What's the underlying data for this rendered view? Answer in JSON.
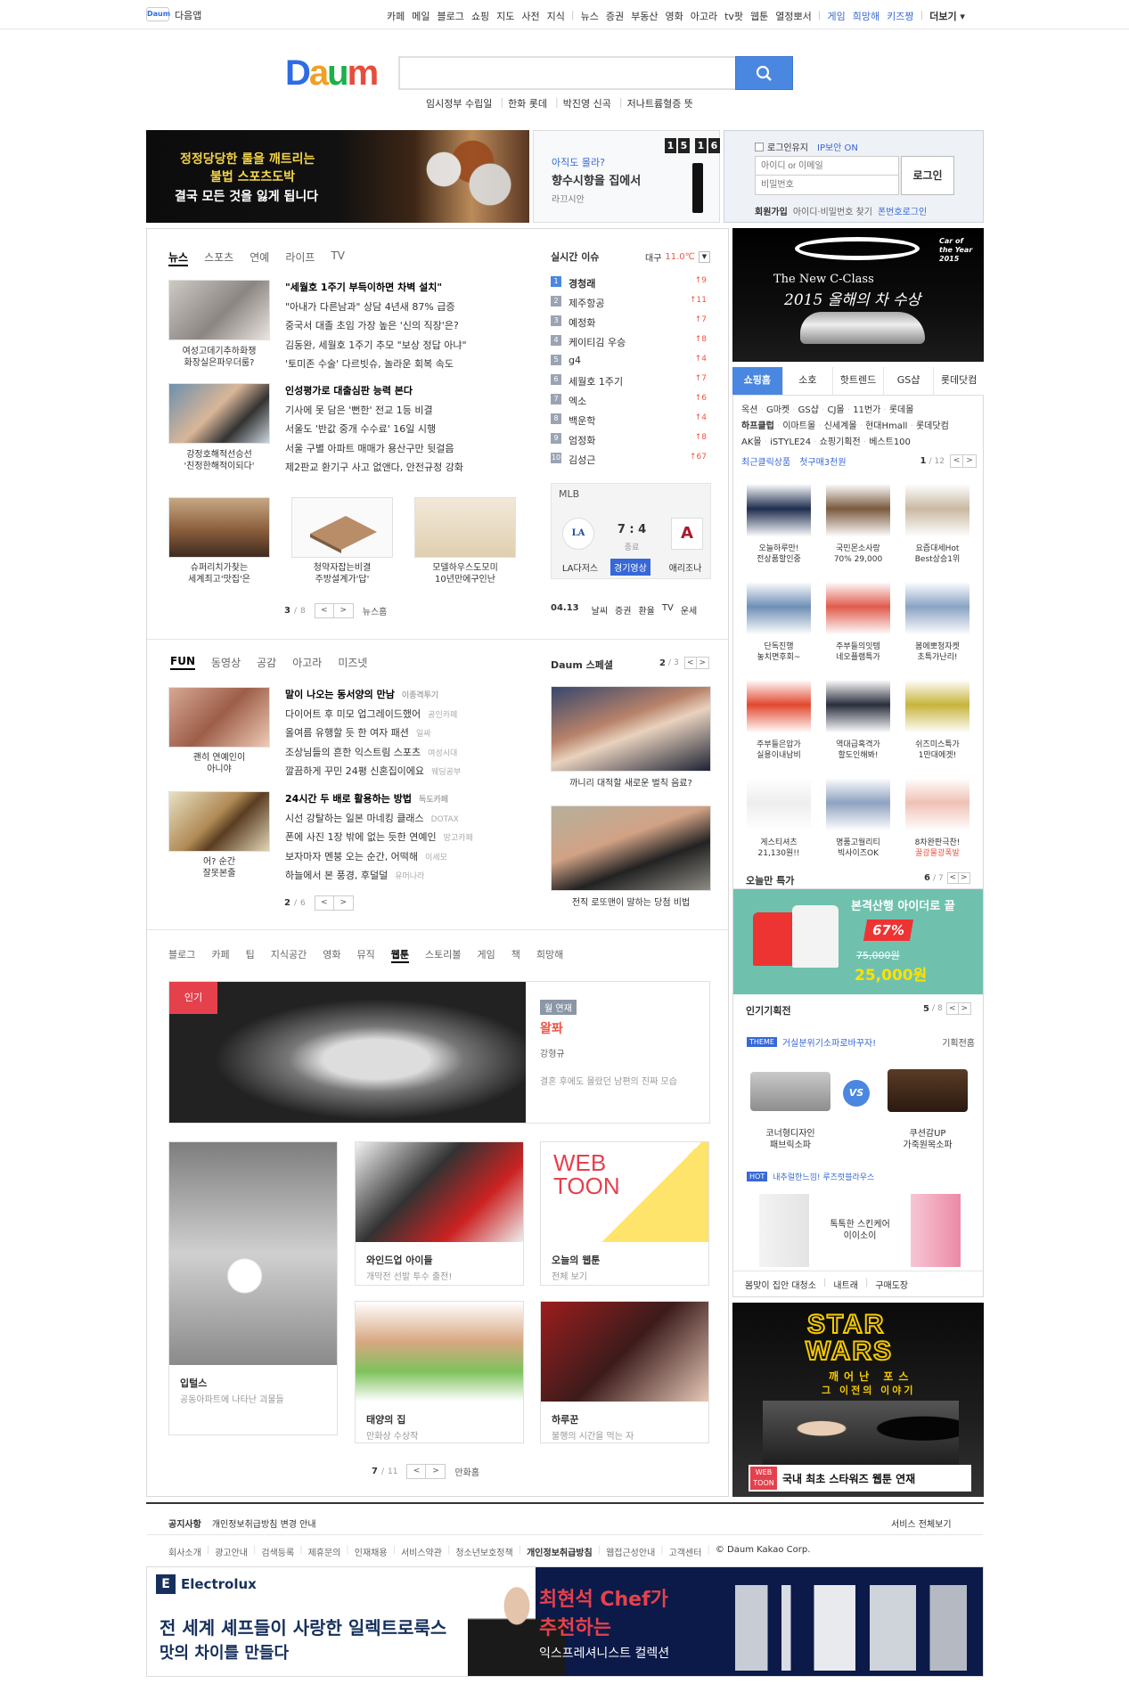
{
  "gnb": {
    "app_name": "다음앱",
    "menu1": [
      "카페",
      "메일",
      "블로그",
      "쇼핑",
      "지도",
      "사전",
      "지식"
    ],
    "menu2": [
      "뉴스",
      "증권",
      "부동산",
      "영화",
      "아고라",
      "tv팟",
      "웹툰",
      "열정뽀서"
    ],
    "menu3": [
      "게임",
      "희망해",
      "키즈짱"
    ],
    "more": "더보기"
  },
  "logo": "Daum",
  "search": {
    "placeholder": ""
  },
  "hot_keywords": [
    "임시정부 수립일",
    "한화 롯데",
    "박진영 신곡",
    "저나트륨혈증 뜻"
  ],
  "banner": {
    "line1": "정정당당한 룰을 깨트리는",
    "line2": "불법 스포츠도박",
    "line3": "결국 모든 것을 잃게 됩니다"
  },
  "ad_small": {
    "q": "아직도 몰라?",
    "title": "향수시향을 집에서",
    "brand": "라끄시안",
    "time": [
      "1",
      "5",
      "1",
      "6"
    ]
  },
  "login": {
    "keep": "로그인유지",
    "ip": "IP보안 ON",
    "id_placeholder": "아이디 or 이메일",
    "pw_placeholder": "비밀번호",
    "button": "로그인",
    "join": "회원가입",
    "find": "아이디·비밀번호 찾기",
    "phone": "폰번호로그인"
  },
  "news": {
    "tabs": [
      "뉴스",
      "스포츠",
      "연예",
      "라이프",
      "TV"
    ],
    "thumb1_cap": [
      "여성고데기추하화쟁",
      "화장실은파우더룸?"
    ],
    "group1": [
      "\"세월호 1주기 부득이하면 차벽 설치\"",
      "\"아내가 다른남과\" 상담 4년새 87% 급증",
      "중국서 대졸 초임 가장 높은 '신의 직장'은?",
      "김동완, 세월호 1주기 추모 \"보상 정답 아냐\"",
      "'토미존 수술' 다르빗슈, 놀라운 회복 속도"
    ],
    "thumb2_cap": [
      "강정호해적선승선",
      "'친정한해적이되다'"
    ],
    "group2": [
      "인성평가로 대출심판 능력 본다",
      "기사에 못 담은 '뻔한' 전교 1등 비결",
      "서울도 '반값 중개 수수료' 16일 시행",
      "서울 구별 아파트 매매가 용산구만 뒷걸음",
      "제2판교 환기구 사고 없앤다, 안전규정 강화"
    ],
    "photos": [
      [
        "슈퍼리치가찾는",
        "세계최고'맛집'은"
      ],
      [
        "청약자잡는비결",
        "주방설계가'답'"
      ],
      [
        "모델하우스도모미",
        "10년만에구인난"
      ]
    ],
    "page": "3",
    "total": "8",
    "more": "뉴스홈"
  },
  "realtime": {
    "title": "실시간 이슈",
    "weather_city": "대구",
    "weather_temp": "11.0℃",
    "items": [
      [
        "1",
        "경청래",
        "9"
      ],
      [
        "2",
        "제주항공",
        "11"
      ],
      [
        "3",
        "예정화",
        "7"
      ],
      [
        "4",
        "케이티김 우승",
        "8"
      ],
      [
        "5",
        "g4",
        "4"
      ],
      [
        "6",
        "세월호 1주기",
        "7"
      ],
      [
        "7",
        "엑소",
        "6"
      ],
      [
        "8",
        "백운학",
        "4"
      ],
      [
        "9",
        "엄정화",
        "8"
      ],
      [
        "10",
        "김성근",
        "67"
      ]
    ]
  },
  "mlb": {
    "label": "MLB",
    "score": "7 : 4",
    "status": "종료",
    "team1": "LA다저스",
    "team2": "애리조나",
    "video": "경기영상"
  },
  "util": {
    "date": "04.13",
    "links": [
      "날씨",
      "증권",
      "환율",
      "TV",
      "운세"
    ]
  },
  "fun": {
    "tabs": [
      "FUN",
      "동영상",
      "공감",
      "아고라",
      "미즈넷"
    ],
    "cap1": [
      "괜히 연예인이",
      "아니야"
    ],
    "group1": [
      [
        "말이 나오는 동서양의 만남",
        "이종격투기"
      ],
      [
        "다이어트 후 미모 업그레이드했어",
        "공인카페"
      ],
      [
        "올여름 유행할 듯 한 여자 패션",
        "일싸"
      ],
      [
        "조상님들의 흔한 익스트림 스포츠",
        "여성시대"
      ],
      [
        "깔끔하게 꾸민 24평 신혼집이에요",
        "웨딩공부"
      ]
    ],
    "cap2": [
      "어? 순간",
      "잘못본줄"
    ],
    "group2": [
      [
        "24시간 두 배로 활용하는 방법",
        "독도카페"
      ],
      [
        "시선 강탈하는 일본 마네킹 클래스",
        "DOTAX"
      ],
      [
        "폰에 사진 1장 밖에 없는 듯한 연예인",
        "망고카페"
      ],
      [
        "보자마자 멘붕 오는 순간, 어떡해",
        "이세모"
      ],
      [
        "하늘에서 본 풍경, 후덜덜",
        "유머나라"
      ]
    ],
    "page": "2",
    "total": "6"
  },
  "special": {
    "title": "Daum 스페셜",
    "page": "2",
    "total": "3",
    "cap1": "까니리 대적할 새로운 벌칙 음료?",
    "cap2": "전직 로또맨이 말하는 당첨 비법"
  },
  "cat_tabs": [
    "블로그",
    "카페",
    "팁",
    "지식공간",
    "영화",
    "뮤직",
    "웹툰",
    "스토리볼",
    "게임",
    "책",
    "희망해"
  ],
  "webtoon": {
    "badge": "인기",
    "feature": {
      "day": "월 연재",
      "title": "왈퐈",
      "author": "강형규",
      "desc": "결혼 후에도 몰랐던 남편의 진짜 모습"
    },
    "items": [
      {
        "title": "입털스",
        "desc": "공동아파트에 나타난 괴물들"
      },
      {
        "title": "와인드업 아이들",
        "desc": "개막전 선발 투수 출전!"
      },
      {
        "title": "오늘의 웹툰",
        "desc": "전체 보기"
      },
      {
        "title": "태양의 집",
        "desc": "만화상 수상작"
      },
      {
        "title": "하루꾼",
        "desc": "불행의 시간을 먹는 자"
      }
    ],
    "page": "7",
    "total": "11",
    "more": "만화홈"
  },
  "car_ad": {
    "logo": "Car of the Year 2015",
    "line1": "The New C-Class",
    "line2": "2015 올해의 차 수상"
  },
  "shopping": {
    "tabs": [
      "쇼핑홈",
      "소호",
      "핫트렌드",
      "GS샵",
      "롯데닷컴"
    ],
    "links1": [
      "옥션",
      "G마켓",
      "GS샵",
      "CJ몰",
      "11번가",
      "롯데몰"
    ],
    "links2": [
      "하프클럽",
      "이마트몰",
      "신세계몰",
      "현대Hmall",
      "롯데닷컴"
    ],
    "links3": [
      "AK몰",
      "iSTYLE24",
      "쇼핑기획전",
      "베스트100"
    ],
    "recent": "최근클릭상품",
    "first": "첫구매3천원",
    "page": "1",
    "total": "12",
    "products": [
      [
        "오늘하루만!",
        "전상품할인중"
      ],
      [
        "국민몬소사랑",
        "70% 29,000"
      ],
      [
        "요즘대세Hot",
        "Best상승1위"
      ],
      [
        "단독진행",
        "놓치면후회~"
      ],
      [
        "주부들의잇템",
        "네오플램특가"
      ],
      [
        "봄에뽀청자켓",
        "초특가난리!"
      ],
      [
        "주부들은압가",
        "실용이내남비"
      ],
      [
        "역대급혹격가",
        "할도인해봐!"
      ],
      [
        "쉬즈미스특가",
        "1만대에겟!"
      ],
      [
        "게스티셔츠",
        "21,130원!!"
      ],
      [
        "명품고월리티",
        "빅사이즈OK"
      ],
      [
        "8차완판극찬!",
        "꿀광물광폭발"
      ]
    ],
    "deal_title": "오늘만 특가",
    "deal_page": "6",
    "deal_total": "7",
    "deal_slogan": "본격산행 아이더로 끝",
    "deal_pct": "67%",
    "deal_was": "75,000원",
    "deal_now": "25,000원"
  },
  "planning": {
    "title": "인기기획전",
    "page": "5",
    "total": "8",
    "theme_badge": "THEME",
    "theme_text": "거실분위기소파로바꾸자!",
    "more": "기획전홈",
    "sofa1": [
      "코너형디자인",
      "패브릭소파"
    ],
    "sofa2": [
      "쿠션감UP",
      "가죽원목소파"
    ],
    "vs": "VS",
    "hot_badge": "HOT",
    "hot_text": "내추럴한느낌! 루즈럿블라우스",
    "skin": [
      "톡톡한 스킨케어",
      "이이소이"
    ],
    "links": [
      "봄맞이 집안 대청소",
      "내트래",
      "구매도장"
    ]
  },
  "starwars": {
    "t1": "STAR",
    "t2": "WARS",
    "sub1": "깨어난 포스",
    "sub2": "그 이전의 이야기",
    "webtoon": "WEB TOON",
    "caption": "국내 최초 스타워즈 웹툰 연재"
  },
  "notice": {
    "label": "공지사항",
    "text": "개인정보취급방침 변경 안내",
    "all": "서비스 전체보기"
  },
  "footer": [
    "회사소개",
    "광고안내",
    "검색등록",
    "제휴문의",
    "인재채용",
    "서비스약관",
    "청소년보호정책",
    "개인정보취급방침",
    "웹접근성안내",
    "고객센터"
  ],
  "copyright": "© Daum Kakao Corp.",
  "electrolux": {
    "brand": "Electrolux",
    "l1": "전 세계 셰프들이 사랑한 일렉트로룩스",
    "l2": "맛의 차이를 만들다",
    "c1": "최현석 Chef가",
    "c2": "추천하는",
    "c3": "익스프레셔니스트 컬렉션"
  }
}
